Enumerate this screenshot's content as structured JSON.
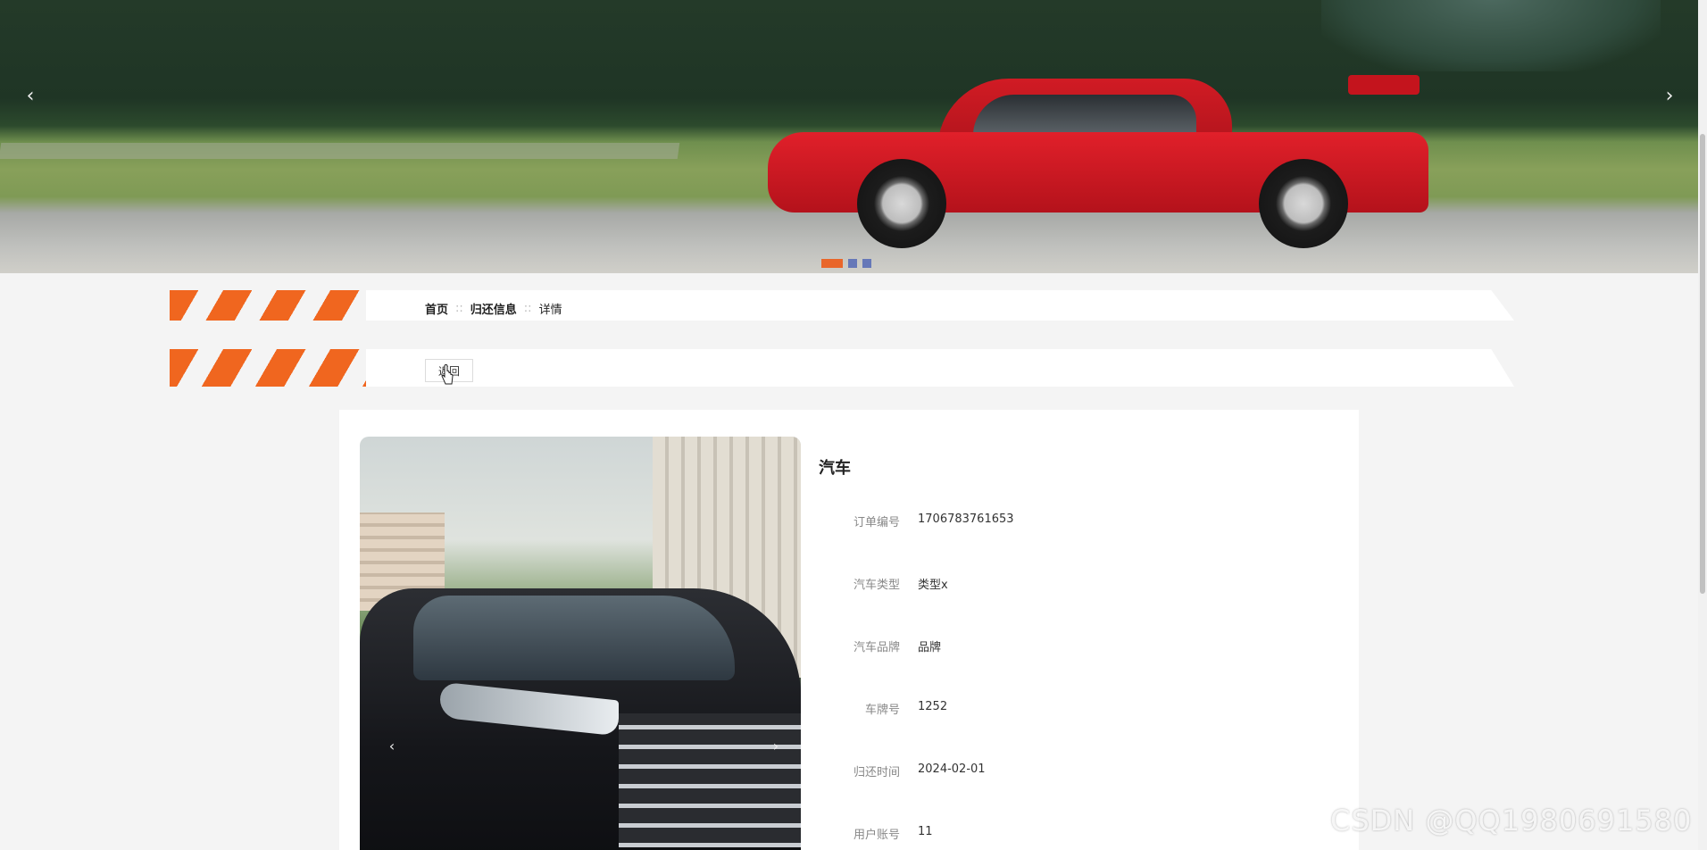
{
  "banner": {
    "prev_arrow": "‹",
    "next_arrow": "›",
    "slides": 3,
    "active_slide": 1
  },
  "breadcrumb": {
    "items": [
      "首页",
      "归还信息",
      "详情"
    ],
    "separator": "::"
  },
  "actions": {
    "back_label": "返回"
  },
  "detail": {
    "title": "汽车",
    "gallery_prev": "‹",
    "gallery_next": "›",
    "fields": [
      {
        "label": "订单编号",
        "value": "1706783761653"
      },
      {
        "label": "汽车类型",
        "value": "类型x"
      },
      {
        "label": "汽车品牌",
        "value": "品牌"
      },
      {
        "label": "车牌号",
        "value": "1252"
      },
      {
        "label": "归还时间",
        "value": "2024-02-01"
      },
      {
        "label": "用户账号",
        "value": "11"
      }
    ]
  },
  "watermark": "CSDN @QQ1980691580",
  "colors": {
    "accent": "#f0661f",
    "dot_inactive": "#6678b8"
  }
}
